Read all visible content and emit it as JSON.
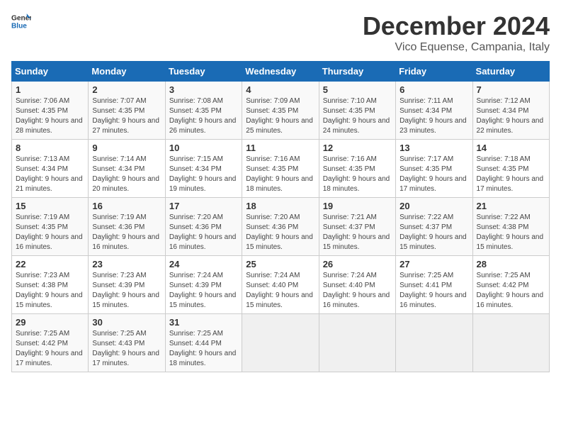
{
  "header": {
    "logo_general": "General",
    "logo_blue": "Blue",
    "month_title": "December 2024",
    "location": "Vico Equense, Campania, Italy"
  },
  "weekdays": [
    "Sunday",
    "Monday",
    "Tuesday",
    "Wednesday",
    "Thursday",
    "Friday",
    "Saturday"
  ],
  "weeks": [
    [
      {
        "day": "1",
        "sunrise": "Sunrise: 7:06 AM",
        "sunset": "Sunset: 4:35 PM",
        "daylight": "Daylight: 9 hours and 28 minutes."
      },
      {
        "day": "2",
        "sunrise": "Sunrise: 7:07 AM",
        "sunset": "Sunset: 4:35 PM",
        "daylight": "Daylight: 9 hours and 27 minutes."
      },
      {
        "day": "3",
        "sunrise": "Sunrise: 7:08 AM",
        "sunset": "Sunset: 4:35 PM",
        "daylight": "Daylight: 9 hours and 26 minutes."
      },
      {
        "day": "4",
        "sunrise": "Sunrise: 7:09 AM",
        "sunset": "Sunset: 4:35 PM",
        "daylight": "Daylight: 9 hours and 25 minutes."
      },
      {
        "day": "5",
        "sunrise": "Sunrise: 7:10 AM",
        "sunset": "Sunset: 4:35 PM",
        "daylight": "Daylight: 9 hours and 24 minutes."
      },
      {
        "day": "6",
        "sunrise": "Sunrise: 7:11 AM",
        "sunset": "Sunset: 4:34 PM",
        "daylight": "Daylight: 9 hours and 23 minutes."
      },
      {
        "day": "7",
        "sunrise": "Sunrise: 7:12 AM",
        "sunset": "Sunset: 4:34 PM",
        "daylight": "Daylight: 9 hours and 22 minutes."
      }
    ],
    [
      {
        "day": "8",
        "sunrise": "Sunrise: 7:13 AM",
        "sunset": "Sunset: 4:34 PM",
        "daylight": "Daylight: 9 hours and 21 minutes."
      },
      {
        "day": "9",
        "sunrise": "Sunrise: 7:14 AM",
        "sunset": "Sunset: 4:34 PM",
        "daylight": "Daylight: 9 hours and 20 minutes."
      },
      {
        "day": "10",
        "sunrise": "Sunrise: 7:15 AM",
        "sunset": "Sunset: 4:34 PM",
        "daylight": "Daylight: 9 hours and 19 minutes."
      },
      {
        "day": "11",
        "sunrise": "Sunrise: 7:16 AM",
        "sunset": "Sunset: 4:35 PM",
        "daylight": "Daylight: 9 hours and 18 minutes."
      },
      {
        "day": "12",
        "sunrise": "Sunrise: 7:16 AM",
        "sunset": "Sunset: 4:35 PM",
        "daylight": "Daylight: 9 hours and 18 minutes."
      },
      {
        "day": "13",
        "sunrise": "Sunrise: 7:17 AM",
        "sunset": "Sunset: 4:35 PM",
        "daylight": "Daylight: 9 hours and 17 minutes."
      },
      {
        "day": "14",
        "sunrise": "Sunrise: 7:18 AM",
        "sunset": "Sunset: 4:35 PM",
        "daylight": "Daylight: 9 hours and 17 minutes."
      }
    ],
    [
      {
        "day": "15",
        "sunrise": "Sunrise: 7:19 AM",
        "sunset": "Sunset: 4:35 PM",
        "daylight": "Daylight: 9 hours and 16 minutes."
      },
      {
        "day": "16",
        "sunrise": "Sunrise: 7:19 AM",
        "sunset": "Sunset: 4:36 PM",
        "daylight": "Daylight: 9 hours and 16 minutes."
      },
      {
        "day": "17",
        "sunrise": "Sunrise: 7:20 AM",
        "sunset": "Sunset: 4:36 PM",
        "daylight": "Daylight: 9 hours and 16 minutes."
      },
      {
        "day": "18",
        "sunrise": "Sunrise: 7:20 AM",
        "sunset": "Sunset: 4:36 PM",
        "daylight": "Daylight: 9 hours and 15 minutes."
      },
      {
        "day": "19",
        "sunrise": "Sunrise: 7:21 AM",
        "sunset": "Sunset: 4:37 PM",
        "daylight": "Daylight: 9 hours and 15 minutes."
      },
      {
        "day": "20",
        "sunrise": "Sunrise: 7:22 AM",
        "sunset": "Sunset: 4:37 PM",
        "daylight": "Daylight: 9 hours and 15 minutes."
      },
      {
        "day": "21",
        "sunrise": "Sunrise: 7:22 AM",
        "sunset": "Sunset: 4:38 PM",
        "daylight": "Daylight: 9 hours and 15 minutes."
      }
    ],
    [
      {
        "day": "22",
        "sunrise": "Sunrise: 7:23 AM",
        "sunset": "Sunset: 4:38 PM",
        "daylight": "Daylight: 9 hours and 15 minutes."
      },
      {
        "day": "23",
        "sunrise": "Sunrise: 7:23 AM",
        "sunset": "Sunset: 4:39 PM",
        "daylight": "Daylight: 9 hours and 15 minutes."
      },
      {
        "day": "24",
        "sunrise": "Sunrise: 7:24 AM",
        "sunset": "Sunset: 4:39 PM",
        "daylight": "Daylight: 9 hours and 15 minutes."
      },
      {
        "day": "25",
        "sunrise": "Sunrise: 7:24 AM",
        "sunset": "Sunset: 4:40 PM",
        "daylight": "Daylight: 9 hours and 15 minutes."
      },
      {
        "day": "26",
        "sunrise": "Sunrise: 7:24 AM",
        "sunset": "Sunset: 4:40 PM",
        "daylight": "Daylight: 9 hours and 16 minutes."
      },
      {
        "day": "27",
        "sunrise": "Sunrise: 7:25 AM",
        "sunset": "Sunset: 4:41 PM",
        "daylight": "Daylight: 9 hours and 16 minutes."
      },
      {
        "day": "28",
        "sunrise": "Sunrise: 7:25 AM",
        "sunset": "Sunset: 4:42 PM",
        "daylight": "Daylight: 9 hours and 16 minutes."
      }
    ],
    [
      {
        "day": "29",
        "sunrise": "Sunrise: 7:25 AM",
        "sunset": "Sunset: 4:42 PM",
        "daylight": "Daylight: 9 hours and 17 minutes."
      },
      {
        "day": "30",
        "sunrise": "Sunrise: 7:25 AM",
        "sunset": "Sunset: 4:43 PM",
        "daylight": "Daylight: 9 hours and 17 minutes."
      },
      {
        "day": "31",
        "sunrise": "Sunrise: 7:25 AM",
        "sunset": "Sunset: 4:44 PM",
        "daylight": "Daylight: 9 hours and 18 minutes."
      },
      null,
      null,
      null,
      null
    ]
  ]
}
